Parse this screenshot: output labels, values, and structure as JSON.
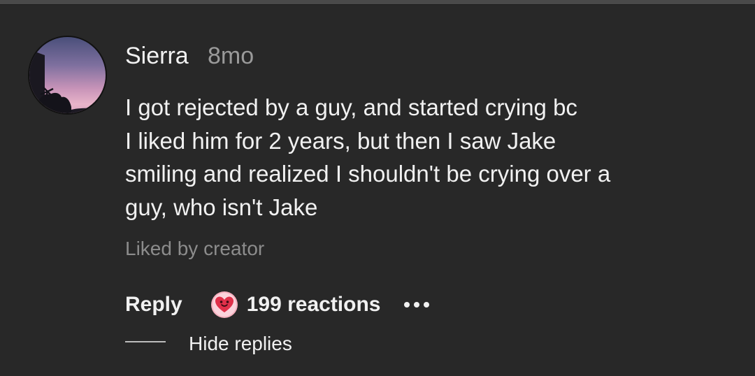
{
  "comment": {
    "username": "Sierra",
    "timestamp": "8mo",
    "body_lines": [
      "I got rejected by a guy, and started crying bc",
      "I liked him for 2 years, but then I saw Jake",
      "smiling and realized I shouldn't be crying over a",
      "guy, who isn't Jake"
    ],
    "liked_by": "Liked by creator",
    "avatar_icon": "sunset-palm-avatar"
  },
  "actions": {
    "reply_label": "Reply",
    "reaction_icon": "heart-face-icon",
    "reactions_label": "199 reactions",
    "more_icon": "more-dots-icon"
  },
  "replies": {
    "hide_label": "Hide replies"
  },
  "colors": {
    "background": "#282828",
    "text_primary": "#f1f1f1",
    "text_secondary": "#8c8c8c",
    "reaction_pink": "#f28aa0",
    "reaction_red": "#e0304a"
  }
}
